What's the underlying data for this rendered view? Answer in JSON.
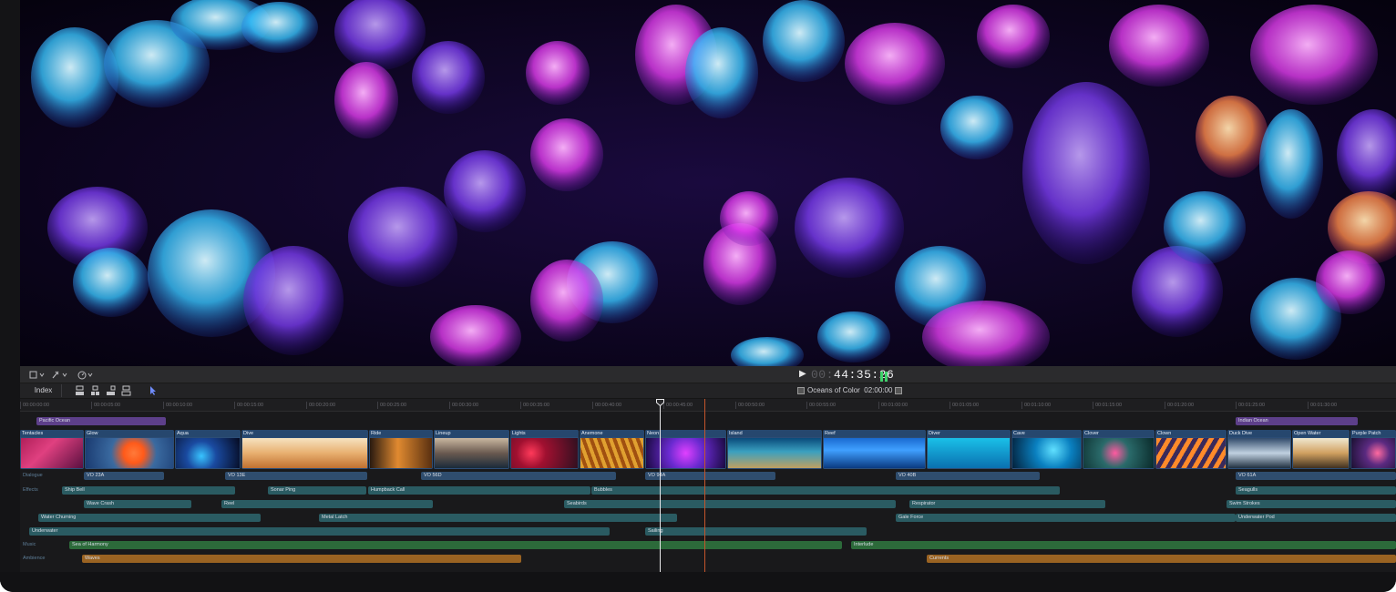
{
  "toolbar": {
    "timecode_dim": "00:",
    "timecode_bright": "44:35:26",
    "play_symbol": "▶"
  },
  "subbar": {
    "index_label": "Index",
    "project_name": "Oceans of Color",
    "project_duration": "02:00:00"
  },
  "ruler": {
    "ticks": [
      "00:00:00:00",
      "00:00:05:00",
      "00:00:10:00",
      "00:00:15:00",
      "00:00:20:00",
      "00:00:25:00",
      "00:00:30:00",
      "00:00:35:00",
      "00:00:40:00",
      "00:00:45:00",
      "00:00:50:00",
      "00:00:55:00",
      "00:01:00:00",
      "00:01:05:00",
      "00:01:10:00",
      "00:01:15:00",
      "00:01:20:00",
      "00:01:25:00",
      "00:01:30:00"
    ]
  },
  "timeline": {
    "top_labels": [
      "Pacific Ocean",
      "Indian Ocean"
    ],
    "clips": [
      "Tentacles",
      "Glow",
      "Aqua",
      "Dive",
      "Ride",
      "Lineup",
      "Lights",
      "Anemone",
      "Neon",
      "Island",
      "Reef",
      "Diver",
      "Cave",
      "Clover",
      "Clown",
      "Duck Dive",
      "Open Water",
      "Purple Patch"
    ],
    "lane_labels": {
      "dialogue": "Dialogue",
      "effects": "Effects",
      "music": "Music",
      "ambience": "Ambience"
    },
    "dialogue": [
      "VO 23A",
      "VO 13E",
      "VO 56D",
      "VO 94A",
      "VO 40B",
      "VO 61A"
    ],
    "effects_row1": [
      "Ship Bell",
      "Sonar Ping",
      "Humpback Call",
      "Bubbles",
      "Seagulls"
    ],
    "effects_row2": [
      "Wave Crash",
      "Reel",
      "Seabirds",
      "Respirator",
      "Swim Strokes"
    ],
    "effects_row3": [
      "Water Churning",
      "Metal Latch",
      "Gale Force",
      "Underwater Pod"
    ],
    "effects_row4": [
      "Underwater",
      "Sailing"
    ],
    "music": [
      "Sea of Harmony",
      "Interlude"
    ],
    "ambience": [
      "Waves",
      "Currents"
    ]
  },
  "colors": {
    "clip_blue": "#2c4d76",
    "dialogue_bar": "#2f4d6e",
    "effects_bar": "#2a5b62",
    "music_bar": "#2c6a3a",
    "ambience_bar": "#9a6322",
    "title_bar": "#5d3f8a",
    "playhead": "#e8e8ea",
    "skimmer": "#c4552b"
  }
}
